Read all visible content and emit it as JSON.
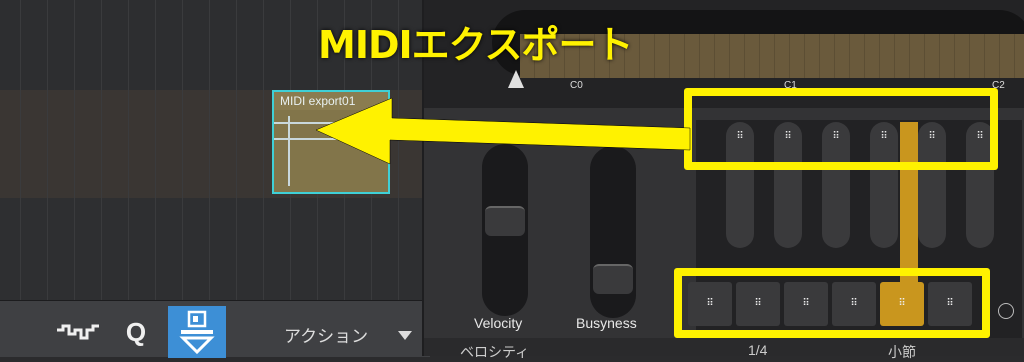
{
  "arrange": {
    "clip_name": "MIDI export01"
  },
  "toolbar": {
    "tools": [
      {
        "name": "squiggle-icon"
      },
      {
        "name": "quantize-icon",
        "glyph": "Q"
      },
      {
        "name": "export-icon"
      }
    ],
    "action_label": "アクション"
  },
  "plugin": {
    "keyboard_labels": [
      "C0",
      "C1",
      "C2"
    ],
    "sliders": [
      {
        "label": "Velocity"
      },
      {
        "label": "Busyness"
      }
    ],
    "footer": {
      "left": "ベロシティ",
      "middle": "1/4",
      "right": "小節"
    },
    "step_dots": "⠿"
  },
  "annotation": {
    "label": "MIDIエクスポート",
    "highlight_color": "#fff200",
    "accent_color": "#c9961e",
    "clip_border_color": "#3fd0d6"
  }
}
